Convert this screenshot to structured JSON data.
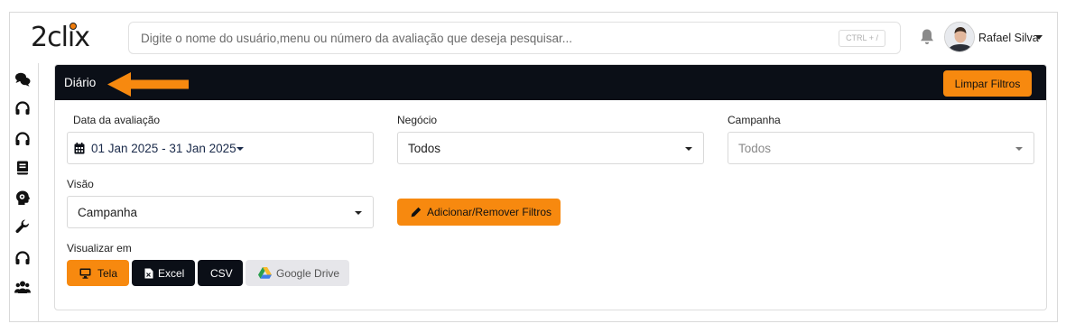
{
  "app": {
    "logo_text": "2clix"
  },
  "search": {
    "placeholder": "Digite o nome do usuário,menu ou número da avaliação que deseja pesquisar...",
    "shortcut": "CTRL + /"
  },
  "user": {
    "name": "Rafael Silva"
  },
  "sidebar": {
    "icons": [
      "chat-bubbles-icon",
      "headset-icon",
      "headset-icon",
      "book-icon",
      "head-gear-icon",
      "wrench-icon",
      "headset-icon",
      "users-icon"
    ]
  },
  "card": {
    "title": "Diário",
    "clear_button": "Limpar Filtros"
  },
  "filters": {
    "date": {
      "label": "Data da avaliação",
      "value": "01 Jan 2025 - 31 Jan 2025"
    },
    "business": {
      "label": "Negócio",
      "value": "Todos"
    },
    "campaign": {
      "label": "Campanha",
      "value": "Todos"
    },
    "view": {
      "label": "Visão",
      "value": "Campanha"
    },
    "add_remove_button": "Adicionar/Remover Filtros"
  },
  "output": {
    "label": "Visualizar em",
    "buttons": [
      "Tela",
      "Excel",
      "CSV",
      "Google Drive"
    ]
  },
  "colors": {
    "accent": "#f7890f",
    "dark": "#0b0f17",
    "muted_button": "#e6e6ea"
  }
}
